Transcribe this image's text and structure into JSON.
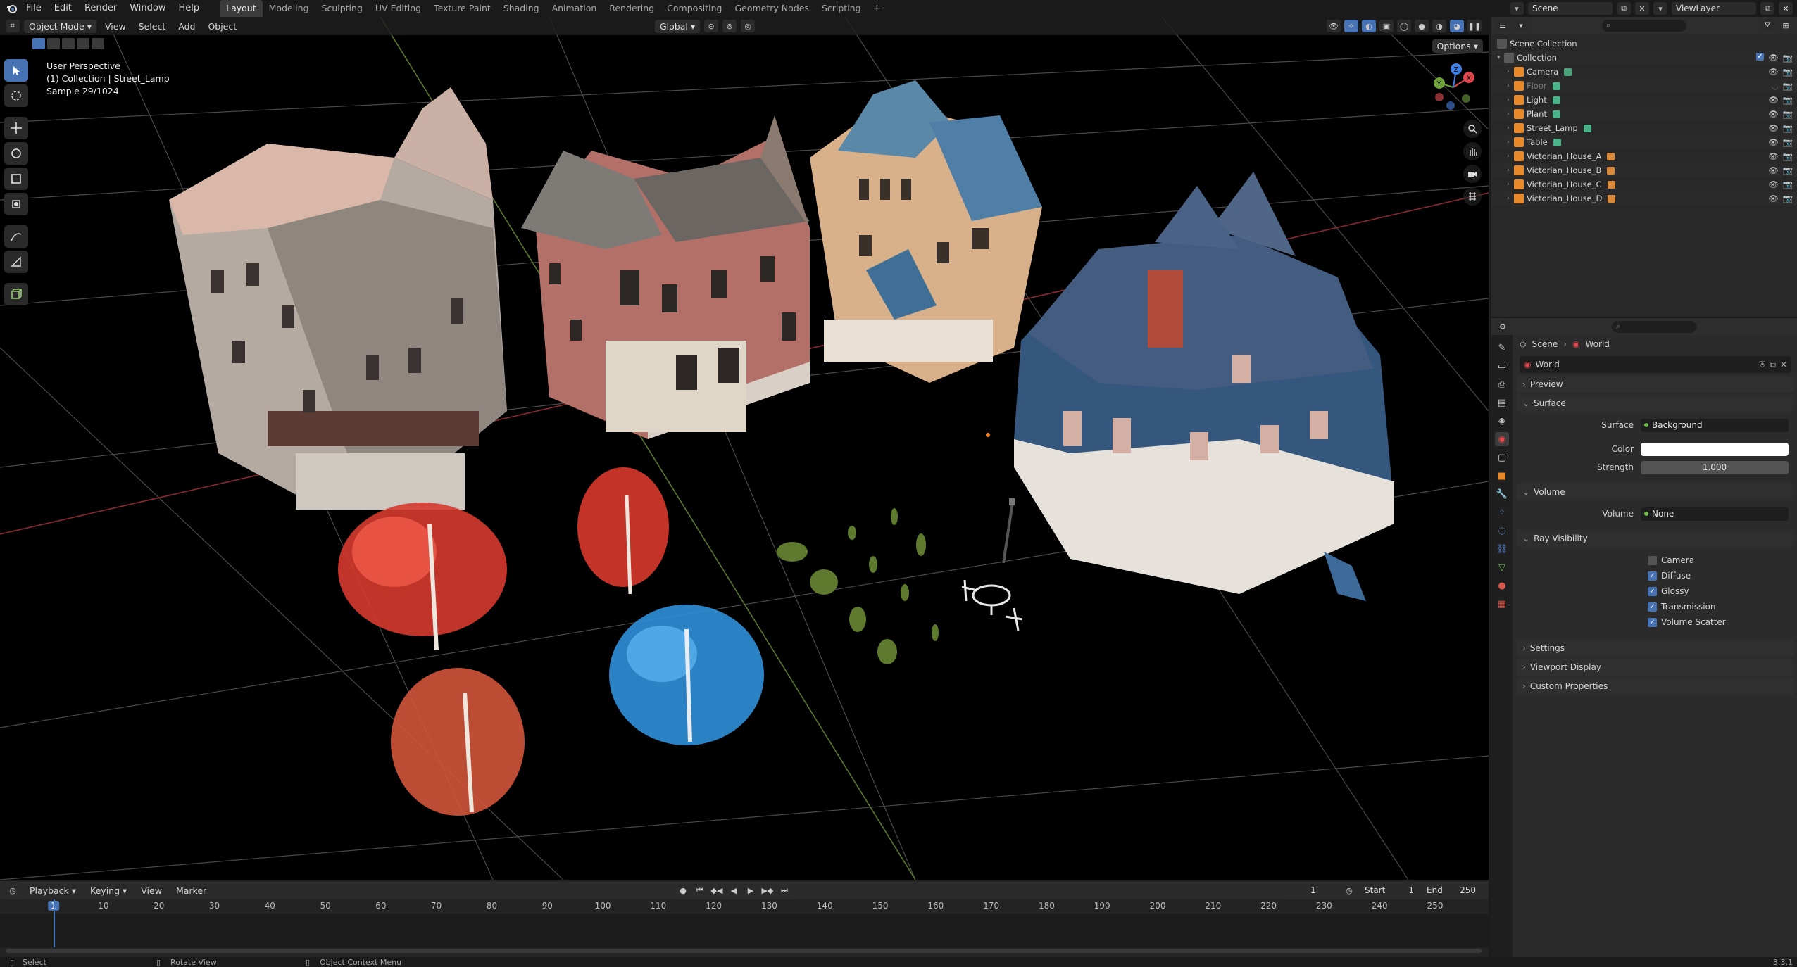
{
  "menubar": {
    "menus": [
      "File",
      "Edit",
      "Render",
      "Window",
      "Help"
    ],
    "workspaces": [
      "Layout",
      "Modeling",
      "Sculpting",
      "UV Editing",
      "Texture Paint",
      "Shading",
      "Animation",
      "Rendering",
      "Compositing",
      "Geometry Nodes",
      "Scripting"
    ],
    "active_workspace": "Layout",
    "scene_name": "Scene",
    "view_layer": "ViewLayer"
  },
  "viewport": {
    "mode": "Object Mode",
    "menus": [
      "View",
      "Select",
      "Add",
      "Object"
    ],
    "orientation": "Global",
    "options_label": "Options",
    "overlay": {
      "perspective": "User Perspective",
      "active": "(1) Collection | Street_Lamp",
      "sample": "Sample 29/1024"
    },
    "gizmo_axes": [
      "X",
      "Y",
      "Z"
    ]
  },
  "outliner": {
    "root": "Scene Collection",
    "collection": "Collection",
    "items": [
      {
        "name": "Camera",
        "icon": "camera-icon",
        "dim": false
      },
      {
        "name": "Floor",
        "icon": "mesh-icon",
        "dim": true
      },
      {
        "name": "Light",
        "icon": "light-icon",
        "dim": false
      },
      {
        "name": "Plant",
        "icon": "mesh-icon",
        "dim": false
      },
      {
        "name": "Street_Lamp",
        "icon": "mesh-icon",
        "dim": false
      },
      {
        "name": "Table",
        "icon": "mesh-icon",
        "dim": false
      },
      {
        "name": "Victorian_House_A",
        "icon": "armature-icon",
        "dim": false
      },
      {
        "name": "Victorian_House_B",
        "icon": "armature-icon",
        "dim": false
      },
      {
        "name": "Victorian_House_C",
        "icon": "armature-icon",
        "dim": false
      },
      {
        "name": "Victorian_House_D",
        "icon": "armature-icon",
        "dim": false
      }
    ]
  },
  "properties": {
    "breadcrumb": [
      "Scene",
      "World"
    ],
    "world_name": "World",
    "panels": {
      "preview": "Preview",
      "surface": "Surface",
      "volume": "Volume",
      "ray_visibility": "Ray Visibility",
      "settings": "Settings",
      "viewport_display": "Viewport Display",
      "custom_properties": "Custom Properties"
    },
    "surface": {
      "surface_label": "Surface",
      "surface_value": "Background",
      "color_label": "Color",
      "color_value": "#ffffff",
      "strength_label": "Strength",
      "strength_value": "1.000"
    },
    "volume": {
      "label": "Volume",
      "value": "None"
    },
    "ray_visibility": [
      {
        "label": "Camera",
        "checked": false
      },
      {
        "label": "Diffuse",
        "checked": true
      },
      {
        "label": "Glossy",
        "checked": true
      },
      {
        "label": "Transmission",
        "checked": true
      },
      {
        "label": "Volume Scatter",
        "checked": true
      }
    ]
  },
  "timeline": {
    "menus": [
      "Playback",
      "Keying",
      "View",
      "Marker"
    ],
    "current_frame": "1",
    "start_label": "Start",
    "start_value": "1",
    "end_label": "End",
    "end_value": "250",
    "ruler": [
      "1",
      "10",
      "20",
      "30",
      "40",
      "50",
      "60",
      "70",
      "80",
      "90",
      "100",
      "110",
      "120",
      "130",
      "140",
      "150",
      "160",
      "170",
      "180",
      "190",
      "200",
      "210",
      "220",
      "230",
      "240",
      "250"
    ]
  },
  "statusbar": {
    "select": "Select",
    "rotate": "Rotate View",
    "context": "Object Context Menu",
    "version": "3.3.1"
  },
  "colors": {
    "accent": "#4772b3",
    "axis_x": "#e0484d",
    "axis_y": "#6fa33a",
    "axis_z": "#3f7fe3"
  }
}
